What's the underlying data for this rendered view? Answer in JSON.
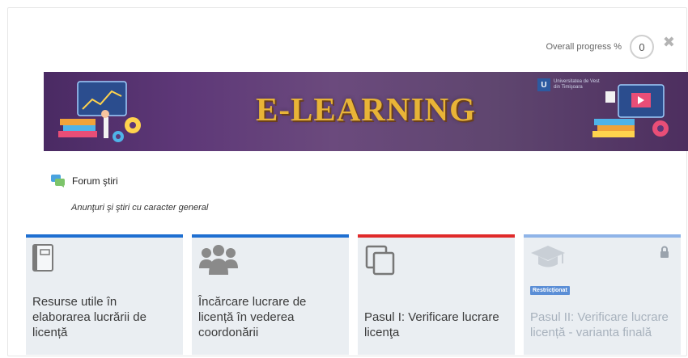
{
  "header": {
    "progress_label": "Overall progress %",
    "progress_value": "0",
    "close_glyph": "✖"
  },
  "banner": {
    "title": "E-LEARNING",
    "university_line1": "Universitatea de Vest",
    "university_line2": "din Timişoara"
  },
  "forum": {
    "label": "Forum ştiri",
    "description": "Anunţuri şi ştiri cu caracter general",
    "icon": "forum-icon"
  },
  "cards": [
    {
      "label": "Resurse utile în elaborarea lucrării de licență",
      "icon": "book-icon",
      "accent": "#1e6fd1"
    },
    {
      "label": "Încărcare lucrare de licență în vederea coordonării",
      "icon": "users-icon",
      "accent": "#1e6fd1"
    },
    {
      "label": "Pasul I: Verificare lucrare licenţa",
      "icon": "copy-icon",
      "accent": "#e02a2a"
    },
    {
      "label": "Pasul II: Verificare lucrare licență - varianta finală",
      "icon": "graduation-cap-icon",
      "accent": "#8fb4e8",
      "badge": "Restricționat",
      "lock": "lock-icon"
    }
  ]
}
